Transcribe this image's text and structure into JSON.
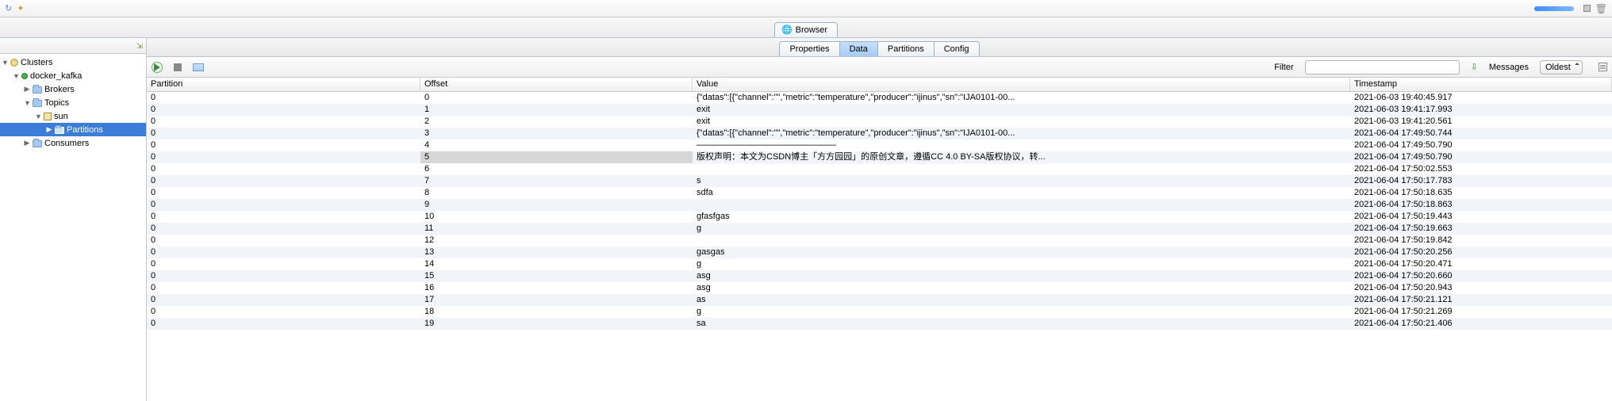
{
  "top": {
    "progress_visible": true
  },
  "browser_tab": {
    "label": "Browser"
  },
  "tree": {
    "root": "Clusters",
    "docker": "docker_kafka",
    "brokers": "Brokers",
    "topics": "Topics",
    "sun": "sun",
    "partitions": "Partitions",
    "consumers": "Consumers"
  },
  "subtabs": {
    "properties": "Properties",
    "data": "Data",
    "partitions": "Partitions",
    "config": "Config"
  },
  "filter": {
    "label": "Filter",
    "value": "",
    "messages_label": "Messages",
    "age_select": "Oldest"
  },
  "columns": {
    "partition": "Partition",
    "offset": "Offset",
    "value": "Value",
    "timestamp": "Timestamp"
  },
  "rows": [
    {
      "p": "0",
      "o": "0",
      "v": "{\"datas\":[{\"channel\":\"\",\"metric\":\"temperature\",\"producer\":\"ijinus\",\"sn\":\"IJA0101-00...",
      "t": "2021-06-03 19:40:45.917"
    },
    {
      "p": "0",
      "o": "1",
      "v": "exit",
      "t": "2021-06-03 19:41:17.993"
    },
    {
      "p": "0",
      "o": "2",
      "v": "exit",
      "t": "2021-06-03 19:41:20.561"
    },
    {
      "p": "0",
      "o": "3",
      "v": "{\"datas\":[{\"channel\":\"\",\"metric\":\"temperature\",\"producer\":\"ijinus\",\"sn\":\"IJA0101-00...",
      "t": "2021-06-04 17:49:50.744"
    },
    {
      "p": "0",
      "o": "4",
      "v": "————————————————",
      "t": "2021-06-04 17:49:50.790"
    },
    {
      "p": "0",
      "o": "5",
      "v": "版权声明：本文为CSDN博主「方方园园」的原创文章，遵循CC 4.0 BY-SA版权协议，转...",
      "t": "2021-06-04 17:49:50.790",
      "sel": true
    },
    {
      "p": "0",
      "o": "6",
      "v": "",
      "t": "2021-06-04 17:50:02.553"
    },
    {
      "p": "0",
      "o": "7",
      "v": "s",
      "t": "2021-06-04 17:50:17.783"
    },
    {
      "p": "0",
      "o": "8",
      "v": "sdfa",
      "t": "2021-06-04 17:50:18.635"
    },
    {
      "p": "0",
      "o": "9",
      "v": "",
      "t": "2021-06-04 17:50:18.863"
    },
    {
      "p": "0",
      "o": "10",
      "v": "gfasfgas",
      "t": "2021-06-04 17:50:19.443"
    },
    {
      "p": "0",
      "o": "11",
      "v": "g",
      "t": "2021-06-04 17:50:19.663"
    },
    {
      "p": "0",
      "o": "12",
      "v": "",
      "t": "2021-06-04 17:50:19.842"
    },
    {
      "p": "0",
      "o": "13",
      "v": "gasgas",
      "t": "2021-06-04 17:50:20.256"
    },
    {
      "p": "0",
      "o": "14",
      "v": "g",
      "t": "2021-06-04 17:50:20.471"
    },
    {
      "p": "0",
      "o": "15",
      "v": "asg",
      "t": "2021-06-04 17:50:20.660"
    },
    {
      "p": "0",
      "o": "16",
      "v": "asg",
      "t": "2021-06-04 17:50:20.943"
    },
    {
      "p": "0",
      "o": "17",
      "v": "as",
      "t": "2021-06-04 17:50:21.121"
    },
    {
      "p": "0",
      "o": "18",
      "v": "g",
      "t": "2021-06-04 17:50:21.269"
    },
    {
      "p": "0",
      "o": "19",
      "v": "sa",
      "t": "2021-06-04 17:50:21.406"
    }
  ]
}
